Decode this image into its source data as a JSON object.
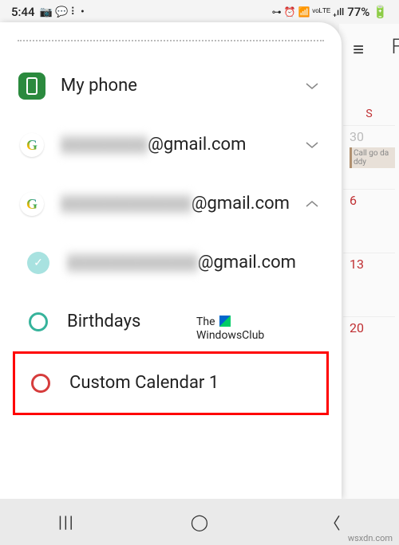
{
  "status": {
    "time": "5:44",
    "left_icons": "📷 💬 ⠇ •",
    "right_icons": "⊶ ⏰ 📶 ᵛᵒᴸᵀᴱ ₊ıll",
    "battery": "77%"
  },
  "background": {
    "menu_icon": "≡",
    "title_peek": "F",
    "day_label": "S",
    "cells": [
      {
        "date": "30",
        "faded": true,
        "event": "Call go da\nddy"
      },
      {
        "date": "6"
      },
      {
        "date": "13"
      },
      {
        "date": "20"
      }
    ]
  },
  "drawer": {
    "rows": [
      {
        "kind": "phone",
        "label": "My phone",
        "chev": "down"
      },
      {
        "kind": "google",
        "blur": "xxxxxxxxxx",
        "suffix": "@gmail.com",
        "chev": "down"
      },
      {
        "kind": "google",
        "blur": "xxxxxxxxxxxxxxx",
        "suffix": "@gmail.com",
        "chev": "up"
      },
      {
        "kind": "check",
        "blur": "xxxxxxxxxxxxxxx",
        "suffix": "@gmail.com"
      },
      {
        "kind": "ring-green",
        "label": "Birthdays"
      },
      {
        "kind": "ring-red",
        "label": "Custom Calendar 1",
        "highlight": true
      }
    ]
  },
  "watermark": {
    "line1": "The",
    "line2": "WindowsClub"
  },
  "nav": {
    "recent": "|||",
    "home": "◯",
    "back": "〈"
  },
  "footer": "wsxdn.com"
}
